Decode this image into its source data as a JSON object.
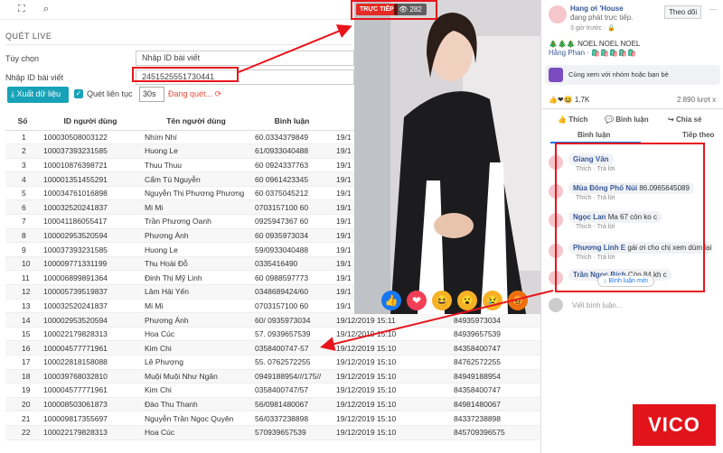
{
  "topbar": {
    "expand_icon": "⛶",
    "search_icon": "⌕"
  },
  "section": {
    "title": "QUÉT LIVE"
  },
  "form": {
    "option_label": "Tùy chọn",
    "option_value": "Nhập ID bài viết",
    "post_id_label": "Nhập ID bài viết",
    "post_id_value": "2451525551730441"
  },
  "toolbar": {
    "export_label": "Xuất dữ liệu",
    "continuous_label": "Quét liên tục",
    "interval_value": "30s",
    "status_text": "Đang quét..."
  },
  "table": {
    "headers": [
      "Số",
      "ID người dùng",
      "Tên người dùng",
      "Bình luận",
      "",
      ""
    ],
    "rows": [
      [
        "1",
        "100030508003122",
        "Nhím Nhí",
        "60.0334379849",
        "19/1",
        ""
      ],
      [
        "2",
        "100037393231585",
        "Huong Le",
        "61/0933040488",
        "19/1",
        ""
      ],
      [
        "3",
        "100010876398721",
        "Thuu Thuu",
        "60 0924337763",
        "19/1",
        ""
      ],
      [
        "4",
        "100001351455291",
        "Cẩm Tú Nguyễn",
        "60 0961423345",
        "19/1",
        ""
      ],
      [
        "5",
        "100034761016898",
        "Nguyễn Thị Phương Phương",
        "60 0375045212",
        "19/1",
        ""
      ],
      [
        "6",
        "100032520241837",
        "Mi Mi",
        "0703157100 60",
        "19/1",
        ""
      ],
      [
        "7",
        "100041186055417",
        "Trần Phương Oanh",
        "0925947367 60",
        "19/1",
        ""
      ],
      [
        "8",
        "100002953520594",
        "Phương Ánh",
        "60 0935973034",
        "19/1",
        ""
      ],
      [
        "9",
        "100037393231585",
        "Huong Le",
        "59/0933040488",
        "19/1",
        ""
      ],
      [
        "10",
        "100009771331199",
        "Thu Hoài Đỗ",
        "0335416490",
        "19/1",
        ""
      ],
      [
        "11",
        "100006899891364",
        "Đinh Thị Mỹ Linh",
        "60 0988597773",
        "19/1",
        ""
      ],
      [
        "12",
        "100005739519837",
        "Lâm Hải Yến",
        "0348689424/60",
        "19/1",
        ""
      ],
      [
        "13",
        "100032520241837",
        "Mi Mi",
        "0703157100 60",
        "19/1",
        ""
      ],
      [
        "14",
        "100002953520594",
        "Phương Ánh",
        "60/ 0935973034",
        "19/12/2019 15:11",
        "84935973034"
      ],
      [
        "15",
        "100022179828313",
        "Hoa Cúc",
        "57. 0939657539",
        "19/12/2019 15:10",
        "84939657539"
      ],
      [
        "16",
        "100004577771961",
        "Kim Chi",
        "0358400747-57",
        "19/12/2019 15:10",
        "84358400747"
      ],
      [
        "17",
        "100022818158088",
        "Lê Phượng",
        "55. 0762572255",
        "19/12/2019 15:10",
        "84762572255"
      ],
      [
        "18",
        "100039768032810",
        "Muội Muội Như Ngân",
        "0949188954///175//",
        "19/12/2019 15:10",
        "84949188954"
      ],
      [
        "19",
        "100004577771961",
        "Kim Chi",
        "0358400747/57",
        "19/12/2019 15:10",
        "84358400747"
      ],
      [
        "20",
        "100008503061873",
        "Đào Thu Thanh",
        "56/0981480067",
        "19/12/2019 15:10",
        "84981480067"
      ],
      [
        "21",
        "100009817355697",
        "Nguyễn Trần Ngọc Quyên",
        "56/0337238898",
        "19/12/2019 15:10",
        "84337238898"
      ],
      [
        "22",
        "100022179828313",
        "Hoa Cúc",
        "570939657539",
        "19/12/2019 15:10",
        "845709396575"
      ]
    ]
  },
  "video": {
    "live_label": "TRỰC TIẾP",
    "viewer_count": "282",
    "eye_icon": "👁"
  },
  "reactions": [
    "👍",
    "❤",
    "😆",
    "😮",
    "😢",
    "😡"
  ],
  "fb": {
    "page_name": "Hang ơi 'House",
    "live_text": "đang phát trực tiếp.",
    "time": "3 giờ trước · 🔒",
    "follow": "Theo dõi",
    "post_text": "🎄🎄🎄 NOEL NOEL NOEL",
    "tags": "Hằng Phan · 🛍️🛍️🛍️🛍️🛍️",
    "shop_text": "Cùng xem với nhóm hoặc bạn bè",
    "likes": "1,7K",
    "views": "2.890 lượt x",
    "like_btn": "Thích",
    "comment_btn": "Bình luận",
    "share_btn": "Chia sẻ",
    "tab_comments": "Bình luận",
    "tab_next": "Tiếp theo",
    "comments": [
      {
        "name": "Giang Văn",
        "text": "",
        "actions": "Thích · Trả lời"
      },
      {
        "name": "Mùa Đông Phố Núi",
        "text": "86.0965645089",
        "actions": "Thích · Trả lời"
      },
      {
        "name": "Ngọc Lan",
        "text": "Ma 67 còn ko c",
        "actions": "Thích · Trả lời"
      },
      {
        "name": "Phương Linh E",
        "text": "gái ơi cho chị xem dùm lại áo e",
        "actions": "Thích · Trả lời"
      },
      {
        "name": "Trần Ngọc Bích",
        "text": "Còn 84 kh c",
        "actions": ""
      }
    ],
    "new_comments": "Bình luận mới",
    "write_comment": "Viết bình luận..."
  },
  "brand": {
    "logo_text": "VICO"
  }
}
